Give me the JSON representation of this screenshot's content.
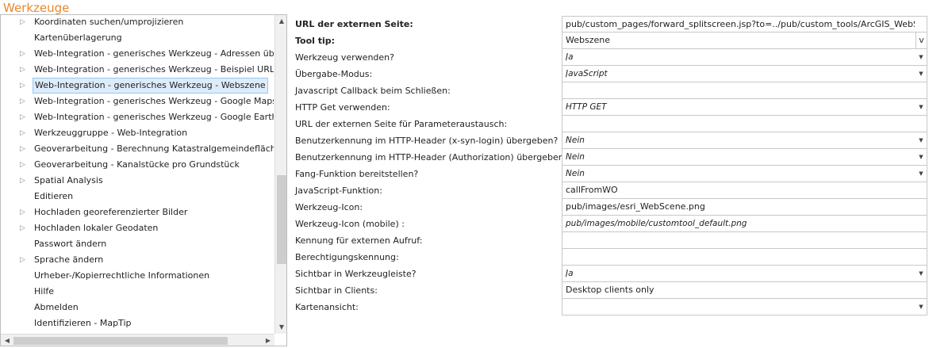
{
  "title": "Werkzeuge",
  "tree": {
    "items": [
      {
        "label": "Koordinaten suchen/umprojizieren",
        "expandable": true,
        "selected": false
      },
      {
        "label": "Kartenüberlagerung",
        "expandable": false,
        "selected": false
      },
      {
        "label": "Web-Integration - generisches Werkzeug - Adressen übergeben",
        "expandable": true,
        "selected": false
      },
      {
        "label": "Web-Integration - generisches Werkzeug - Beispiel URL Aufruf",
        "expandable": true,
        "selected": false
      },
      {
        "label": "Web-Integration - generisches Werkzeug - Webszene",
        "expandable": true,
        "selected": true
      },
      {
        "label": "Web-Integration - generisches Werkzeug - Google Maps",
        "expandable": true,
        "selected": false
      },
      {
        "label": "Web-Integration - generisches Werkzeug - Google Earth",
        "expandable": true,
        "selected": false
      },
      {
        "label": "Werkzeuggruppe - Web-Integration",
        "expandable": true,
        "selected": false
      },
      {
        "label": "Geoverarbeitung - Berechnung Katastralgemeindefläche",
        "expandable": true,
        "selected": false
      },
      {
        "label": "Geoverarbeitung - Kanalstücke pro Grundstück",
        "expandable": true,
        "selected": false
      },
      {
        "label": "Spatial Analysis",
        "expandable": true,
        "selected": false
      },
      {
        "label": "Editieren",
        "expandable": false,
        "selected": false
      },
      {
        "label": "Hochladen georeferenzierter Bilder",
        "expandable": true,
        "selected": false
      },
      {
        "label": "Hochladen lokaler Geodaten",
        "expandable": true,
        "selected": false
      },
      {
        "label": "Passwort ändern",
        "expandable": false,
        "selected": false
      },
      {
        "label": "Sprache ändern",
        "expandable": true,
        "selected": false
      },
      {
        "label": "Urheber-/Kopierrechtliche Informationen",
        "expandable": false,
        "selected": false
      },
      {
        "label": "Hilfe",
        "expandable": false,
        "selected": false
      },
      {
        "label": "Abmelden",
        "expandable": false,
        "selected": false
      },
      {
        "label": "Identifizieren - MapTip",
        "expandable": false,
        "selected": false
      }
    ],
    "vscroll_position": 0.72,
    "hscroll_position": 0.0
  },
  "icons": {
    "expand": "triangle-right-icon",
    "dropdown": "chevron-down-icon",
    "scroll_up": "triangle-up-icon",
    "scroll_down": "triangle-down-icon",
    "scroll_left": "triangle-left-icon",
    "scroll_right": "triangle-right-icon"
  },
  "properties": [
    {
      "label": "URL der externen Seite:",
      "bold": true,
      "value": "pub/custom_pages/forward_splitscreen.jsp?to=../pub/custom_tools/ArcGIS_WebScene.htm",
      "type": "text",
      "italic": false
    },
    {
      "label": "Tool tip:",
      "bold": true,
      "value": "Webszene",
      "type": "text-v",
      "italic": false,
      "button_label": "v"
    },
    {
      "label": "Werkzeug verwenden?",
      "bold": false,
      "value": "Ja",
      "type": "dropdown",
      "italic": true
    },
    {
      "label": "Übergabe-Modus:",
      "bold": false,
      "value": "JavaScript",
      "type": "dropdown",
      "italic": true
    },
    {
      "label": "Javascript Callback beim Schließen:",
      "bold": false,
      "value": "",
      "type": "text",
      "italic": false
    },
    {
      "label": "HTTP Get verwenden:",
      "bold": false,
      "value": "HTTP GET",
      "type": "dropdown",
      "italic": true
    },
    {
      "label": "URL der externen Seite für Parameteraustausch:",
      "bold": false,
      "value": "",
      "type": "text",
      "italic": false
    },
    {
      "label": "Benutzerkennung im HTTP-Header (x-syn-login) übergeben?",
      "bold": false,
      "value": "Nein",
      "type": "dropdown",
      "italic": true
    },
    {
      "label": "Benutzerkennung im HTTP-Header (Authorization) übergeben?",
      "bold": false,
      "value": "Nein",
      "type": "dropdown",
      "italic": true
    },
    {
      "label": "Fang-Funktion bereitstellen?",
      "bold": false,
      "value": "Nein",
      "type": "dropdown",
      "italic": true
    },
    {
      "label": "JavaScript-Funktion:",
      "bold": false,
      "value": "callFromWO",
      "type": "text",
      "italic": false
    },
    {
      "label": "Werkzeug-Icon:",
      "bold": false,
      "value": "pub/images/esri_WebScene.png",
      "type": "text",
      "italic": false
    },
    {
      "label": "Werkzeug-Icon (mobile) :",
      "bold": false,
      "value": "pub/images/mobile/customtool_default.png",
      "type": "text",
      "italic": true
    },
    {
      "label": "Kennung für externen Aufruf:",
      "bold": false,
      "value": "",
      "type": "text",
      "italic": false
    },
    {
      "label": "Berechtigungskennung:",
      "bold": false,
      "value": "",
      "type": "text",
      "italic": false
    },
    {
      "label": "Sichtbar in Werkzeugleiste?",
      "bold": false,
      "value": "Ja",
      "type": "dropdown",
      "italic": true
    },
    {
      "label": "Sichtbar in Clients:",
      "bold": false,
      "value": "Desktop clients only",
      "type": "text",
      "italic": false
    },
    {
      "label": "Kartenansicht:",
      "bold": false,
      "value": "",
      "type": "dropdown",
      "italic": false
    }
  ]
}
